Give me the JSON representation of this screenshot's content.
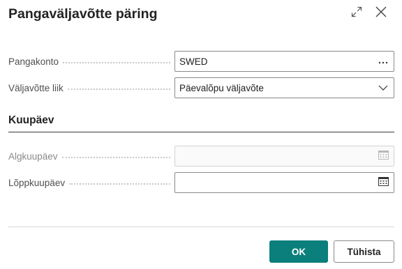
{
  "dialog": {
    "title": "Pangaväljavõtte päring"
  },
  "fields": {
    "bank_account": {
      "label": "Pangakonto",
      "value": "SWED"
    },
    "statement_type": {
      "label": "Väljavõtte liik",
      "value": "Päevalõpu väljavõte"
    }
  },
  "date_section": {
    "title": "Kuupäev",
    "start_date": {
      "label": "Algkuupäev",
      "value": ""
    },
    "end_date": {
      "label": "Lõppkuupäev",
      "value": ""
    }
  },
  "footer": {
    "ok_label": "OK",
    "cancel_label": "Tühista"
  },
  "icons": {
    "expand": "expand-icon",
    "close": "close-icon",
    "lookup": "ellipsis-icon",
    "dropdown": "chevron-down-icon",
    "calendar": "calendar-icon"
  },
  "colors": {
    "accent": "#0b7f7c"
  }
}
